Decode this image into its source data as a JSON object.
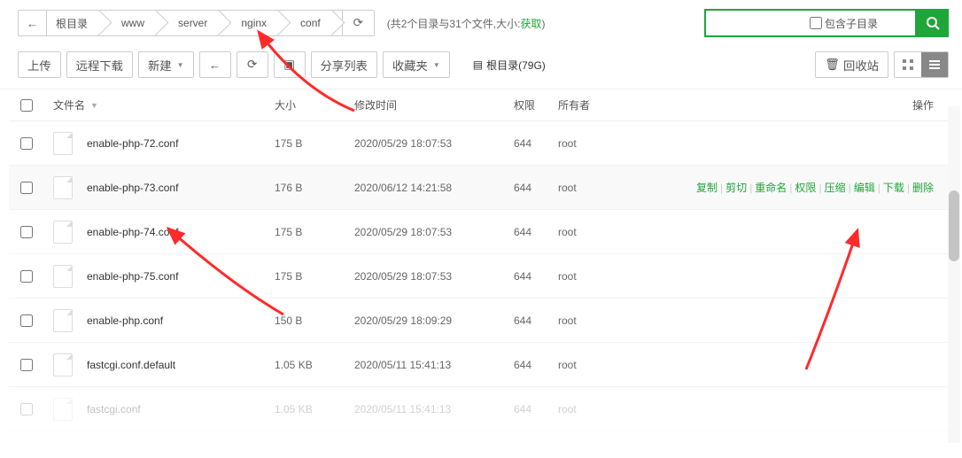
{
  "breadcrumb": {
    "items": [
      "根目录",
      "www",
      "server",
      "nginx",
      "conf"
    ]
  },
  "summary": {
    "prefix": "(共2个目录与31个文件,大小:",
    "link": "获取",
    "suffix": ")"
  },
  "search": {
    "placeholder": "",
    "subdir_label": "包含子目录"
  },
  "toolbar": {
    "upload": "上传",
    "remote": "远程下载",
    "new": "新建",
    "share": "分享列表",
    "fav": "收藏夹",
    "root_label": "根目录(79G)",
    "recycle": "回收站"
  },
  "columns": {
    "name": "文件名",
    "size": "大小",
    "date": "修改时间",
    "perm": "权限",
    "owner": "所有者",
    "ops": "操作"
  },
  "ops": {
    "copy": "复制",
    "cut": "剪切",
    "rename": "重命名",
    "perm": "权限",
    "zip": "压缩",
    "edit": "编辑",
    "download": "下载",
    "delete": "删除"
  },
  "files": [
    {
      "name": "enable-php-72.conf",
      "size": "175 B",
      "date": "2020/05/29 18:07:53",
      "perm": "644",
      "owner": "root"
    },
    {
      "name": "enable-php-73.conf",
      "size": "176 B",
      "date": "2020/06/12 14:21:58",
      "perm": "644",
      "owner": "root"
    },
    {
      "name": "enable-php-74.conf",
      "size": "175 B",
      "date": "2020/05/29 18:07:53",
      "perm": "644",
      "owner": "root"
    },
    {
      "name": "enable-php-75.conf",
      "size": "175 B",
      "date": "2020/05/29 18:07:53",
      "perm": "644",
      "owner": "root"
    },
    {
      "name": "enable-php.conf",
      "size": "150 B",
      "date": "2020/05/29 18:09:29",
      "perm": "644",
      "owner": "root"
    },
    {
      "name": "fastcgi.conf.default",
      "size": "1.05 KB",
      "date": "2020/05/11 15:41:13",
      "perm": "644",
      "owner": "root"
    },
    {
      "name": "fastcgi.conf",
      "size": "1.05 KB",
      "date": "2020/05/11 15:41:13",
      "perm": "644",
      "owner": "root"
    }
  ]
}
